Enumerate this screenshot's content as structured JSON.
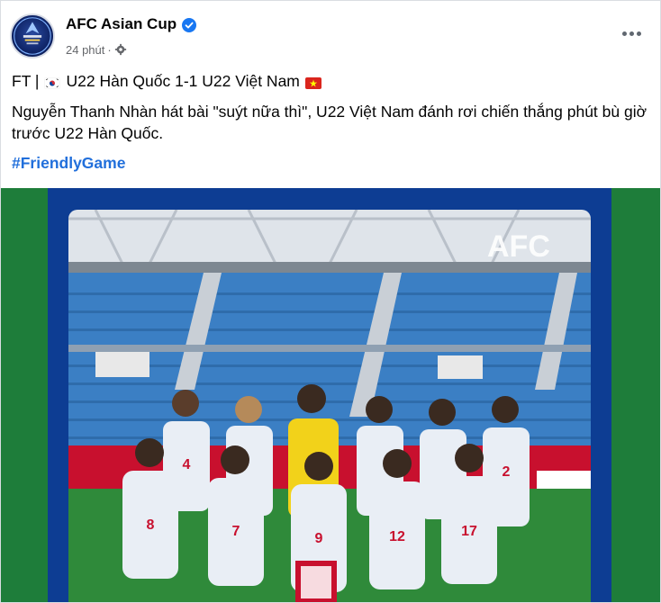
{
  "post": {
    "page_name": "AFC Asian Cup",
    "timestamp": "24 phút",
    "separator": "·",
    "privacy_icon": "gear-icon",
    "verified_icon": "verified-badge-icon",
    "more_icon": "more-options-icon"
  },
  "content": {
    "line1_prefix": "FT |",
    "line1_match": "U22 Hàn Quốc 1-1 U22 Việt Nam",
    "line2": "Nguyễn Thanh Nhàn hát bài \"suýt nữa thì\", U22 Việt Nam đánh rơi chiến thắng phút bù giờ trước U22 Hàn Quốc.",
    "hashtag": "#FriendlyGame"
  },
  "image": {
    "watermark": "AFC",
    "jersey_numbers": [
      "4",
      "",
      "",
      "",
      "",
      "2",
      "8",
      "7",
      "9",
      "12",
      "17"
    ],
    "colors": {
      "frame": "#0d3d93",
      "side_panel": "#1e7d3a",
      "stands": "#3b7fc4",
      "kit": "#e9eef5"
    }
  }
}
